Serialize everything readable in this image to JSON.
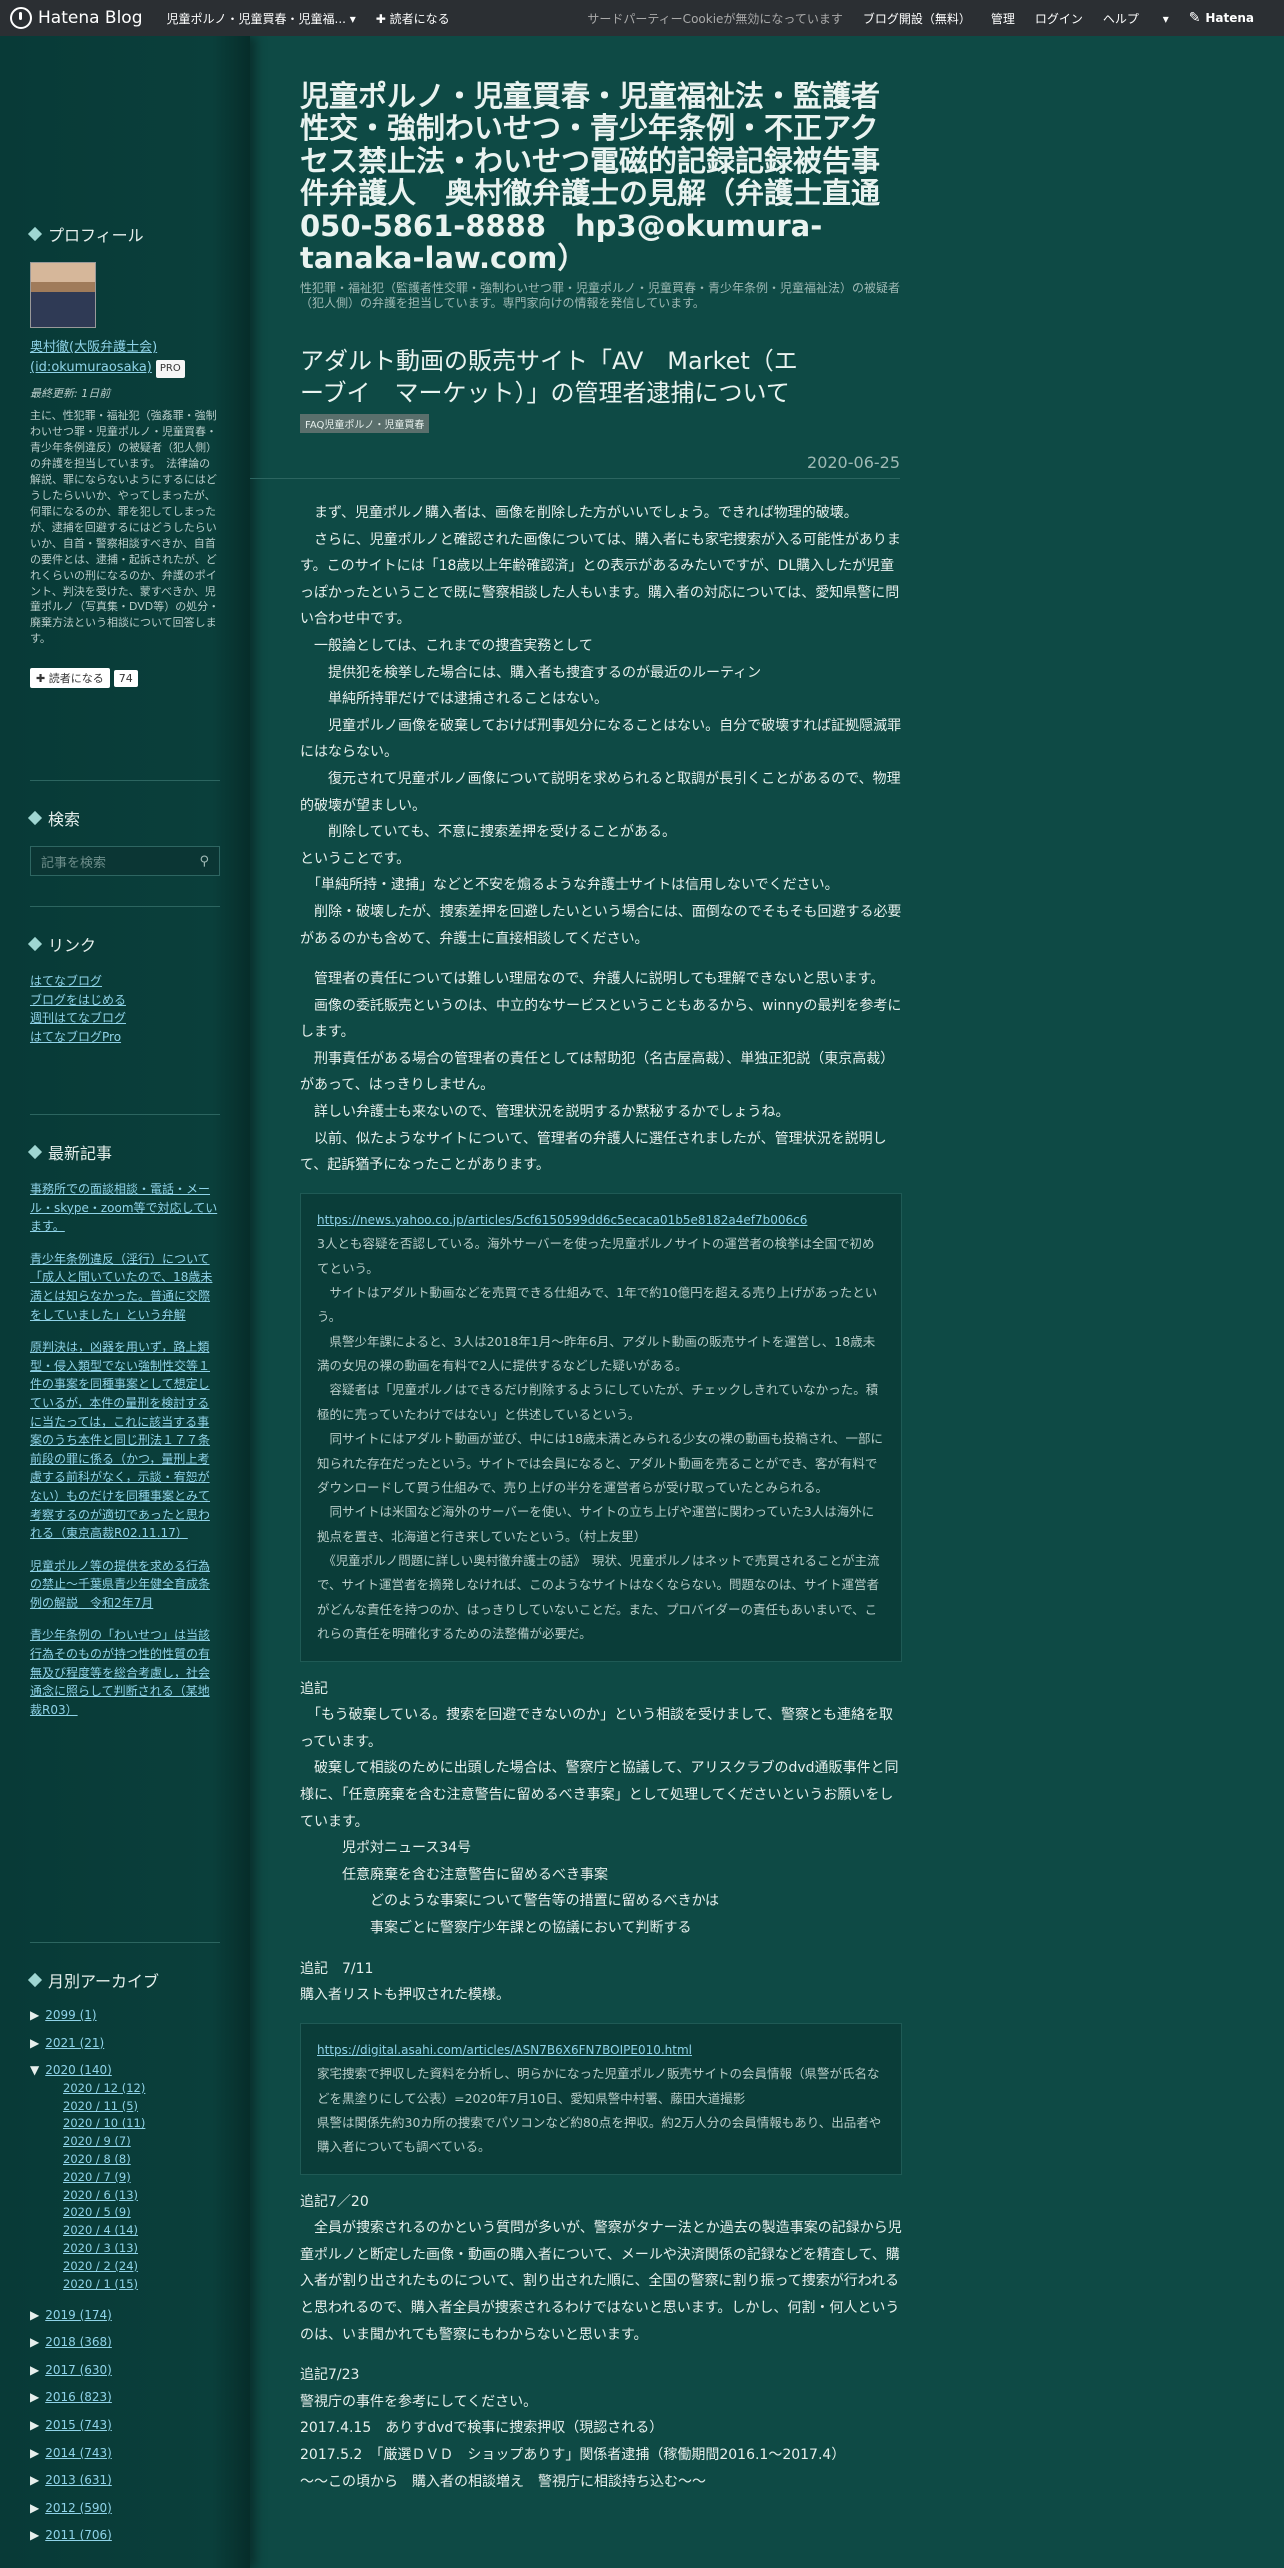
{
  "globalbar": {
    "logo": "Hatena Blog",
    "blog_title": "児童ポルノ・児童買春・児童福...",
    "follow": "✚ 読者になる",
    "cookie": "サードパーティーCookieが無効になっています",
    "open_blog": "ブログ開設（無料）",
    "manage": "管理",
    "login": "ログイン",
    "help": "ヘルプ",
    "brand": "Hatena"
  },
  "header": {
    "title": "児童ポルノ・児童買春・児童福祉法・監護者性交・強制わいせつ・青少年条例・不正アクセス禁止法・わいせつ電磁的記録記録被告事件弁護人　奥村徹弁護士の見解（弁護士直通050-5861-8888　hp3@okumura-tanaka-law.com）",
    "description": "性犯罪・福祉犯（監護者性交罪・強制わいせつ罪・児童ポルノ・児童買春・青少年条例・児童福祉法）の被疑者（犯人側）の弁護を担当しています。専門家向けの情報を発信しています。"
  },
  "entry": {
    "title": "アダルト動画の販売サイト「AV　Market（エーブイ　マーケット）」の管理者逮捕について",
    "category": "FAQ児童ポルノ・児童買春",
    "date": "2020-06-25",
    "paragraphs": [
      "　まず、児童ポルノ購入者は、画像を削除した方がいいでしょう。できれば物理的破壊。",
      "　さらに、児童ポルノと確認された画像については、購入者にも家宅捜索が入る可能性があります。このサイトには「18歳以上年齢確認済」との表示があるみたいですが、DL購入したが児童っぽかったということで既に警察相談した人もいます。購入者の対応については、愛知県警に問い合わせ中です。",
      "　一般論としては、これまでの捜査実務として",
      "　　提供犯を検挙した場合には、購入者も捜査するのが最近のルーティン",
      "　　単純所持罪だけでは逮捕されることはない。",
      "　　児童ポルノ画像を破棄しておけば刑事処分になることはない。自分で破壊すれば証拠隠滅罪にはならない。",
      "　　復元されて児童ポルノ画像について説明を求められると取調が長引くことがあるので、物理的破壊が望ましい。",
      "　　削除していても、不意に捜索差押を受けることがある。",
      "ということです。",
      "　「単純所持・逮捕」などと不安を煽るような弁護士サイトは信用しないでください。",
      "　削除・破壊したが、捜索差押を回避したいという場合には、面倒なのでそもそも回避する必要があるのかも含めて、弁護士に直接相談してください。"
    ],
    "paragraphs2": [
      "　管理者の責任については難しい理屈なので、弁護人に説明しても理解できないと思います。",
      "　画像の委託販売というのは、中立的なサービスということもあるから、winnyの最判を参考にします。",
      "　刑事責任がある場合の管理者の責任としては幇助犯（名古屋高裁）、単独正犯説（東京高裁）があって、はっきりしません。",
      "　詳しい弁護士も来ないので、管理状況を説明するか黙秘するかでしょうね。",
      "　以前、似たようなサイトについて、管理者の弁護人に選任されましたが、管理状況を説明して、起訴猶予になったことがあります。"
    ],
    "quote1_link": "https://news.yahoo.co.jp/articles/5cf6150599dd6c5ecaca01b5e8182a4ef7b006c6",
    "quote1": [
      "3人とも容疑を否認している。海外サーバーを使った児童ポルノサイトの運営者の検挙は全国で初めてという。",
      "　サイトはアダルト動画などを売買できる仕組みで、1年で約10億円を超える売り上げがあったという。",
      "　県警少年課によると、3人は2018年1月～昨年6月、アダルト動画の販売サイトを運営し、18歳未満の女児の裸の動画を有料で2人に提供するなどした疑いがある。",
      "　容疑者は「児童ポルノはできるだけ削除するようにしていたが、チェックしきれていなかった。積極的に売っていたわけではない」と供述しているという。",
      "　同サイトにはアダルト動画が並び、中には18歳未満とみられる少女の裸の動画も投稿され、一部に知られた存在だったという。サイトでは会員になると、アダルト動画を売ることができ、客が有料でダウンロードして買う仕組みで、売り上げの半分を運営者らが受け取っていたとみられる。",
      "　同サイトは米国など海外のサーバーを使い、サイトの立ち上げや運営に関わっていた3人は海外に拠点を置き、北海道と行き来していたという。（村上友里）",
      "　《児童ポルノ問題に詳しい奥村徹弁護士の話》　現状、児童ポルノはネットで売買されることが主流で、サイト運営者を摘発しなければ、このようなサイトはなくならない。問題なのは、サイト運営者がどんな責任を持つのか、はっきりしていないことだ。また、プロバイダーの責任もあいまいで、これらの責任を明確化するための法整備が必要だ。"
    ],
    "addendum1_title": "追記",
    "addendum1": [
      "　「もう破棄している。捜索を回避できないのか」という相談を受けまして、警察とも連絡を取っています。",
      "　破棄して相談のために出頭した場合は、警察庁と協議して、アリスクラブのdvd通販事件と同様に、「任意廃棄を含む注意警告に留めるべき事案」として処理してくださいというお願いをしています。",
      "　　　児ポ対ニュース34号",
      "　　　任意廃棄を含む注意警告に留めるべき事案",
      "　　　　　どのような事案について警告等の措置に留めるべきかは",
      "　　　　　事案ごとに警察庁少年課との協議において判断する"
    ],
    "addendum2_title": "追記　7/11",
    "addendum2": "購入者リストも押収された模様。",
    "quote2_link": "https://digital.asahi.com/articles/ASN7B6X6FN7BOIPE010.html",
    "quote2": [
      "家宅捜索で押収した資料を分析し、明らかになった児童ポルノ販売サイトの会員情報（県警が氏名などを黒塗りにして公表）=2020年7月10日、愛知県警中村署、藤田大道撮影",
      "県警は関係先約30カ所の捜索でパソコンなど約80点を押収。約2万人分の会員情報もあり、出品者や購入者についても調べている。"
    ],
    "addendum3_title": "追記7／20",
    "addendum3": "　全員が捜索されるのかという質問が多いが、警察がタナー法とか過去の製造事案の記録から児童ポルノと断定した画像・動画の購入者について、メールや決済関係の記録などを精査して、購入者が割り出されたものについて、割り出された順に、全国の警察に割り振って捜索が行われると思われるので、購入者全員が捜索されるわけではないと思います。しかし、何割・何人というのは、いま聞かれても警察にもわからないと思います。",
    "addendum4_title": "追記7/23",
    "addendum4": [
      "警視庁の事件を参考にしてください。",
      "2017.4.15　ありすdvdで検事に捜索押収（現認される）",
      "2017.5.2　「厳選ＤＶＤ　ショップありす」関係者逮捕（稼働期間2016.1～2017.4）",
      "～～この頃から　購入者の相談増え　警視庁に相談持ち込む～～"
    ]
  },
  "sidebar": {
    "profile_heading": "プロフィール",
    "profile_name": "奥村徹(大阪弁護士会)",
    "profile_id": "(id:okumuraosaka)",
    "pro": "PRO",
    "last_updated": "最終更新: 1日前",
    "profile_text": "主に、性犯罪・福祉犯（強姦罪・強制わいせつ罪・児童ポルノ・児童買春・青少年条例違反）の被疑者（犯人側）の弁護を担当しています。　法律論の解説、罪にならないようにするにはどうしたらいいか、やってしまったが、何罪になるのか、罪を犯してしまったが、逮捕を回避するにはどうしたらいいか、自首・警察相談すべきか、自首の要件とは、逮捕・起訴されたが、どれくらいの刑になるのか、弁護のポイント、判決を受けた、蒙すべきか、児童ポルノ（写真集・DVD等）の処分・廃棄方法という相談について回答します。",
    "follow": "✚ 読者になる",
    "follow_count": "74",
    "search_heading": "検索",
    "search_placeholder": "記事を検索",
    "links_heading": "リンク",
    "links": [
      "はてなブログ",
      "ブログをはじめる",
      "週刊はてなブログ",
      "はてなブログPro"
    ],
    "recent_heading": "最新記事",
    "recent": [
      "事務所での面談相談・電話・メール・skype・zoom等で対応しています。",
      "青少年条例違反（淫行）について「成人と聞いていたので、18歳未満とは知らなかった。普通に交際をしていました」という弁解",
      "原判決は，凶器を用いず，路上類型・侵入類型でない強制性交等１件の事案を同種事案として想定しているが，本件の量刑を検討するに当たっては，これに該当する事案のうち本件と同じ刑法１７７条前段の罪に係る（かつ，量刑上考慮する前科がなく，示談・宥恕がない）ものだけを同種事案とみて考察するのが適切であったと思われる（東京高裁R02.11.17）",
      "児童ポルノ等の提供を求める行為の禁止～千葉県青少年健全育成条例の解説　令和2年7月",
      "青少年条例の「わいせつ」は当該行為そのものが持つ性的性質の有無及び程度等を総合考慮し，社会通念に照らして判断される（某地裁R03）"
    ],
    "archive_heading": "月別アーカイブ",
    "archive_years_top": [
      "2099 (1)",
      "2021 (21)"
    ],
    "archive_open": "2020 (140)",
    "archive_months": [
      "2020 / 12 (12)",
      "2020 / 11 (5)",
      "2020 / 10 (11)",
      "2020 / 9 (7)",
      "2020 / 8 (8)",
      "2020 / 7 (9)",
      "2020 / 6 (13)",
      "2020 / 5 (9)",
      "2020 / 4 (14)",
      "2020 / 3 (13)",
      "2020 / 2 (24)",
      "2020 / 1 (15)"
    ],
    "archive_years_bottom": [
      "2019 (174)",
      "2018 (368)",
      "2017 (630)",
      "2016 (823)",
      "2015 (743)",
      "2014 (743)",
      "2013 (631)",
      "2012 (590)",
      "2011 (706)"
    ]
  }
}
